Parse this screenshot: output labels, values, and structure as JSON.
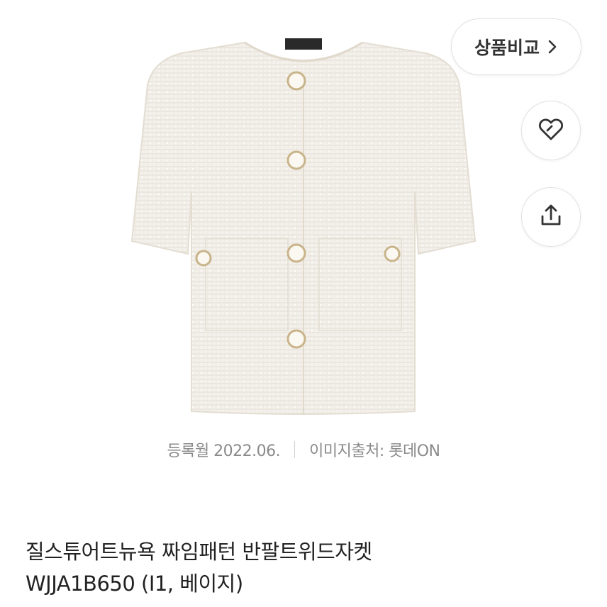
{
  "product_image": {
    "alt": "tweed-jacket"
  },
  "actions": {
    "compare_label": "상품비교",
    "compare_icon": "chevron-right-icon",
    "wishlist_icon": "heart-tag-icon",
    "share_icon": "share-icon"
  },
  "meta": {
    "registered": "등록월 2022.06.",
    "image_source": "이미지출처: 롯데ON"
  },
  "product": {
    "title_line1": "질스튜어트뉴욕 짜임패턴 반팔트위드자켓",
    "title_line2": "WJJA1B650 (I1, 베이지)"
  },
  "colors": {
    "jacket": "#f3efe8",
    "button_gold": "#c9b48a",
    "meta_text": "#8a8a8a"
  }
}
